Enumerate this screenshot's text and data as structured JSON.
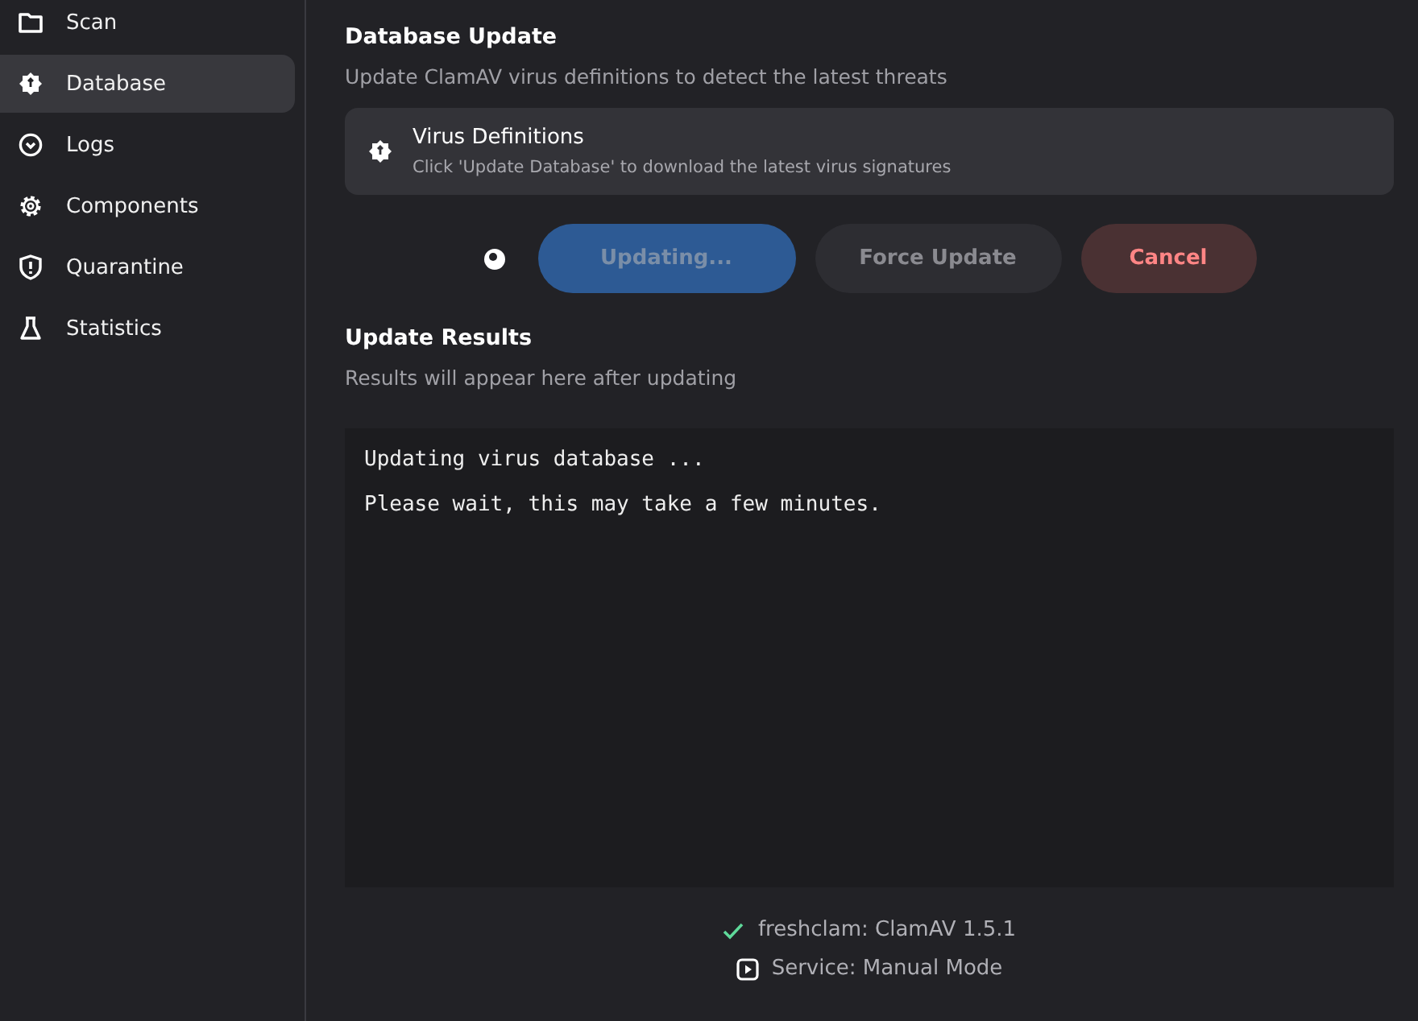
{
  "sidebar": {
    "items": [
      {
        "label": "Scan",
        "selected": false
      },
      {
        "label": "Database",
        "selected": true
      },
      {
        "label": "Logs",
        "selected": false
      },
      {
        "label": "Components",
        "selected": false
      },
      {
        "label": "Quarantine",
        "selected": false
      },
      {
        "label": "Statistics",
        "selected": false
      }
    ]
  },
  "header": {
    "title": "Database Update",
    "subtitle": "Update ClamAV virus definitions to detect the latest threats"
  },
  "card": {
    "title": "Virus Definitions",
    "description": "Click 'Update Database' to download the latest virus signatures"
  },
  "busy": true,
  "buttons": [
    {
      "label": "Updating...",
      "kind": "primary",
      "disabled": true
    },
    {
      "label": "Force Update",
      "kind": "secondary",
      "disabled": true
    },
    {
      "label": "Cancel",
      "kind": "danger",
      "disabled": false
    }
  ],
  "results": {
    "title": "Update Results",
    "subtitle": "Results will appear here after updating",
    "lines": [
      "Updating virus database ...",
      "Please wait, this may take a few minutes."
    ]
  },
  "status": [
    {
      "kind": "check",
      "text": "freshclam: ClamAV 1.5.1"
    },
    {
      "kind": "play",
      "text": "Service: Manual Mode"
    }
  ]
}
